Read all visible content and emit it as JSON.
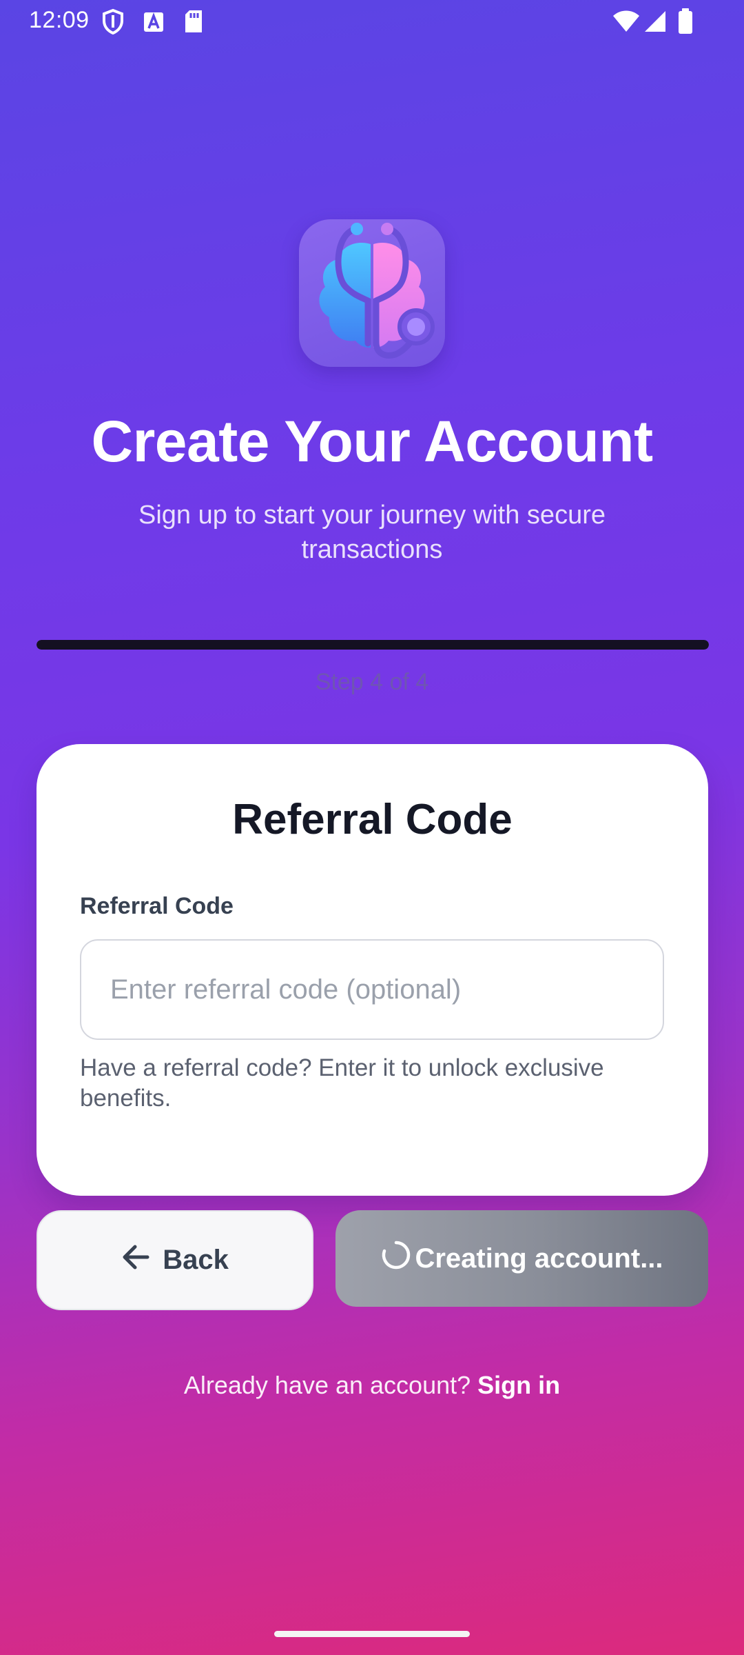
{
  "status_bar": {
    "time": "12:09",
    "left_icons": [
      "shield-icon",
      "font-a-icon",
      "sd-card-icon"
    ],
    "right_icons": [
      "wifi-icon",
      "cellular-signal-icon",
      "battery-icon"
    ]
  },
  "header": {
    "logo_icon": "brain-stethoscope-logo-icon",
    "title": "Create Your Account",
    "subtitle": "Sign up to start your journey with secure transactions"
  },
  "progress": {
    "current_step": 4,
    "total_steps": 4,
    "fraction": 1.0,
    "label": "Step 4 of 4",
    "fill_color": "#141022"
  },
  "card": {
    "title": "Referral Code",
    "field_label": "Referral Code",
    "input_value": "",
    "input_placeholder": "Enter referral code (optional)",
    "helper_text": "Have a referral code? Enter it to unlock exclusive benefits."
  },
  "buttons": {
    "back_icon": "arrow-left-icon",
    "back_label": "Back",
    "submit_icon": "spinner-icon",
    "submit_label": "Creating account..."
  },
  "footer": {
    "prompt": "Already have an account?",
    "link": "Sign in"
  },
  "colors": {
    "background_top": "#5a45e4",
    "background_bottom": "#dc2a7c",
    "card": "#ffffff",
    "submit_button": "#8a8e99"
  }
}
